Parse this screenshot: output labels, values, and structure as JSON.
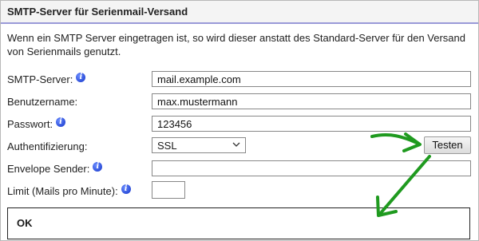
{
  "section": {
    "title": "SMTP-Server für Serienmail-Versand",
    "description": "Wenn ein SMTP Server eingetragen ist, so wird dieser anstatt des Standard-Server für den Versand von Serienmails genutzt."
  },
  "fields": {
    "smtp_server": {
      "label": "SMTP-Server:",
      "value": "mail.example.com"
    },
    "username": {
      "label": "Benutzername:",
      "value": "max.mustermann"
    },
    "password": {
      "label": "Passwort:",
      "value": "123456"
    },
    "auth": {
      "label": "Authentifizierung:",
      "value": "SSL"
    },
    "envelope_sender": {
      "label": "Envelope Sender:",
      "value": ""
    },
    "limit": {
      "label": "Limit (Mails pro Minute):",
      "value": ""
    }
  },
  "test_button": {
    "label": "Testen"
  },
  "result": {
    "text": "OK"
  },
  "colors": {
    "arrow": "#1f9a1f",
    "title_underline": "#9a9ad8",
    "info_icon": "#1233c8"
  },
  "icons": {
    "info": "info-icon",
    "select_chevron": "chevron-down-icon",
    "annotation": "green-arrow"
  }
}
